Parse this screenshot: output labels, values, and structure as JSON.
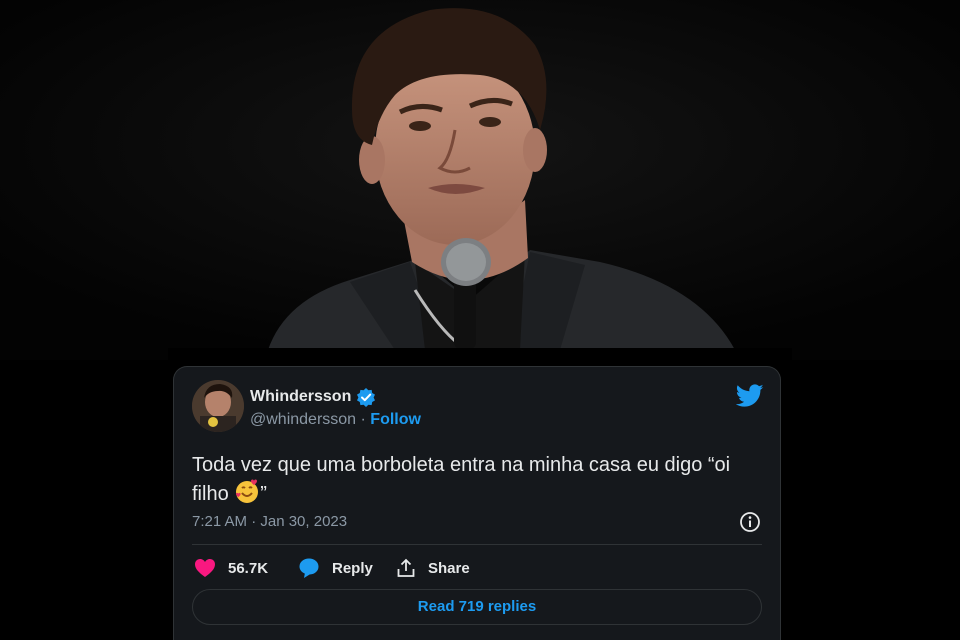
{
  "tweet": {
    "display_name": "Whindersson",
    "handle": "@whindersson",
    "separator": " · ",
    "follow_label": "Follow",
    "text_before_emoji": "Toda vez que uma borboleta entra na minha casa eu digo “oi filho ",
    "text_after_emoji": "”",
    "timestamp": "7:21 AM · Jan 30, 2023",
    "likes": "56.7K",
    "reply_label": "Reply",
    "share_label": "Share",
    "read_replies_label": "Read 719 replies"
  },
  "icons": {
    "verified": "verified-badge-icon",
    "brand": "twitter-bird-icon",
    "info": "info-icon",
    "like": "heart-icon",
    "reply": "speech-bubble-icon",
    "share": "share-upload-icon",
    "emoji": "smiling-face-with-hearts-emoji"
  },
  "colors": {
    "background": "#000000",
    "card": "#15181c",
    "text": "#e7e9ea",
    "secondary_text": "#8b98a5",
    "accent": "#1d9bf0",
    "like": "#f91880"
  }
}
